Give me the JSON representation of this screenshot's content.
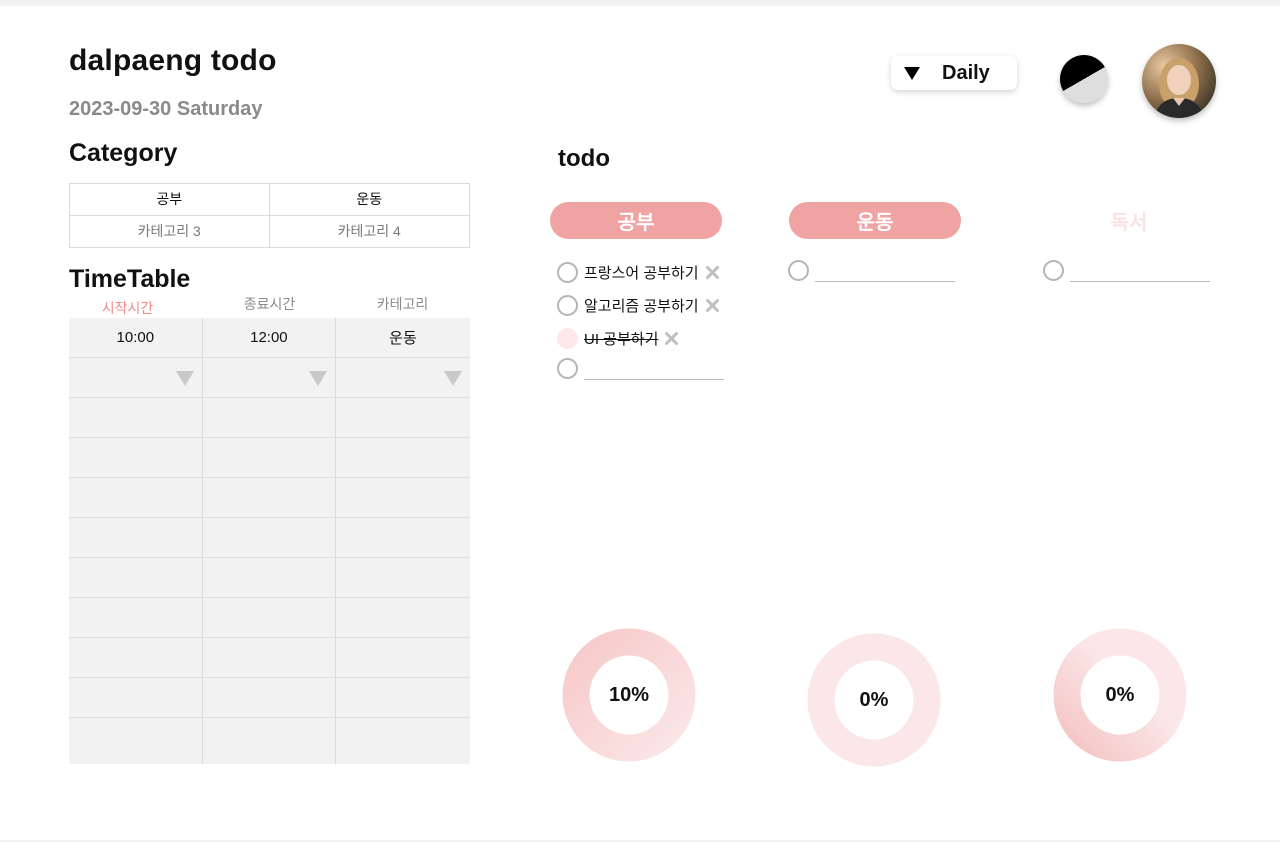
{
  "app": {
    "title": "dalpaeng todo",
    "date": "2023-09-30 Saturday"
  },
  "header": {
    "view_mode": "Daily"
  },
  "category": {
    "heading": "Category",
    "cells": [
      "공부",
      "운동",
      "카테고리 3",
      "카테고리 4"
    ]
  },
  "timetable": {
    "heading": "TimeTable",
    "columns": [
      "시작시간",
      "종료시간",
      "카테고리"
    ],
    "rows": [
      {
        "start": "10:00",
        "end": "12:00",
        "category": "운동"
      }
    ]
  },
  "todo": {
    "heading": "todo",
    "categories": [
      {
        "name": "공부",
        "items": [
          {
            "text": "프랑스어 공부하기",
            "done": false
          },
          {
            "text": "알고리즘 공부하기",
            "done": false
          },
          {
            "text": "UI 공부하기",
            "done": true
          }
        ]
      },
      {
        "name": "운동",
        "items": []
      },
      {
        "name": "독서",
        "items": []
      }
    ]
  },
  "progress": [
    {
      "label": "10%",
      "value": 10
    },
    {
      "label": "0%",
      "value": 0
    },
    {
      "label": "0%",
      "value": 0
    }
  ],
  "colors": {
    "accent": "#f0a3a3",
    "accent_light": "#fbe2e2",
    "done_fill": "#fde8e8"
  }
}
